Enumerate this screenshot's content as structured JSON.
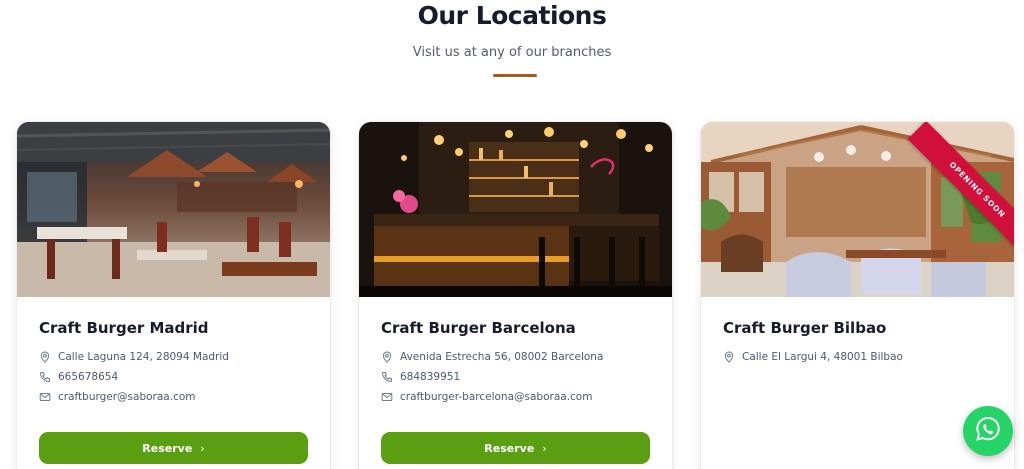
{
  "section": {
    "title": "Our Locations",
    "subtitle": "Visit us at any of our branches",
    "accent_color": "#a65a1f"
  },
  "locations": [
    {
      "name": "Craft Burger Madrid",
      "address": "Calle Laguna 124, 28094 Madrid",
      "phone": "665678654",
      "email": "craftburger@saboraa.com",
      "button_label": "Reserve"
    },
    {
      "name": "Craft Burger Barcelona",
      "address": "Avenida Estrecha 56, 08002 Barcelona",
      "phone": "684839951",
      "email": "craftburger-barcelona@saboraa.com",
      "button_label": "Reserve"
    },
    {
      "name": "Craft Burger Bilbao",
      "address": "Calle El Largui 4, 48001 Bilbao",
      "badge": "OPENING SOON"
    }
  ],
  "colors": {
    "button": "#5a9e12",
    "badge": "#d0103a",
    "whatsapp": "#25d366"
  },
  "icons": {
    "address": "location-pin-icon",
    "phone": "phone-icon",
    "email": "mail-icon",
    "button": "chevron-right-icon",
    "floating": "whatsapp-icon"
  }
}
